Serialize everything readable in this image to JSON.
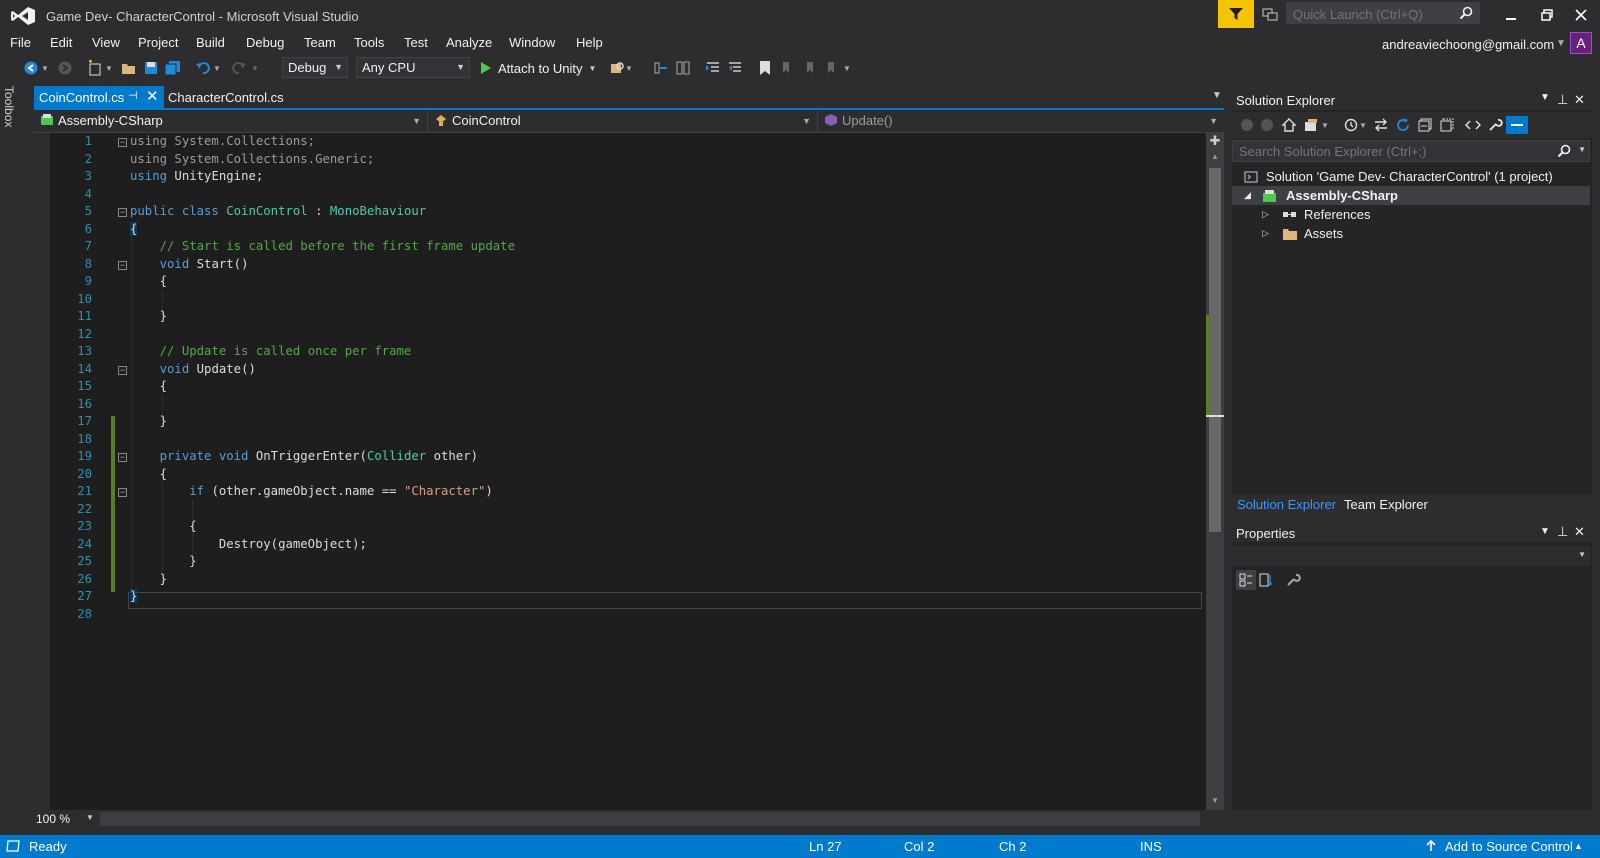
{
  "window": {
    "title": "Game Dev- CharacterControl - Microsoft Visual Studio",
    "quick_launch_placeholder": "Quick Launch (Ctrl+Q)"
  },
  "menu": [
    "File",
    "Edit",
    "View",
    "Project",
    "Build",
    "Debug",
    "Team",
    "Tools",
    "Test",
    "Analyze",
    "Window",
    "Help"
  ],
  "account": {
    "email": "andreaviechoong@gmail.com",
    "avatar_letter": "A"
  },
  "toolbar": {
    "configuration": "Debug",
    "platform": "Any CPU",
    "attach_label": "Attach to Unity"
  },
  "toolbox_label": "Toolbox",
  "tabs": [
    {
      "label": "CoinControl.cs",
      "active": true
    },
    {
      "label": "CharacterControl.cs",
      "active": false
    }
  ],
  "navbar": {
    "project": "Assembly-CSharp",
    "type": "CoinControl",
    "member": "Update()"
  },
  "editor": {
    "line_numbers": [
      "1",
      "2",
      "3",
      "4",
      "5",
      "6",
      "7",
      "8",
      "9",
      "10",
      "11",
      "12",
      "13",
      "14",
      "15",
      "16",
      "17",
      "18",
      "19",
      "20",
      "21",
      "22",
      "23",
      "24",
      "25",
      "26",
      "27",
      "28"
    ],
    "zoom": "100 %"
  },
  "solution_explorer": {
    "title": "Solution Explorer",
    "search_placeholder": "Search Solution Explorer (Ctrl+;)",
    "solution_label": "Solution 'Game Dev- CharacterControl' (1 project)",
    "project_label": "Assembly-CSharp",
    "items": [
      "References",
      "Assets"
    ],
    "tabs": [
      "Solution Explorer",
      "Team Explorer"
    ]
  },
  "properties": {
    "title": "Properties"
  },
  "status": {
    "ready": "Ready",
    "line": "Ln 27",
    "col": "Col 2",
    "ch": "Ch 2",
    "mode": "INS",
    "source_control": "Add to Source Control"
  },
  "colors": {
    "accent": "#007acc",
    "filter_button": "#f5c400",
    "avatar": "#68217a",
    "keyword": "#569cd6",
    "type": "#4ec9b0",
    "comment": "#57a64a",
    "string": "#d69d85"
  }
}
